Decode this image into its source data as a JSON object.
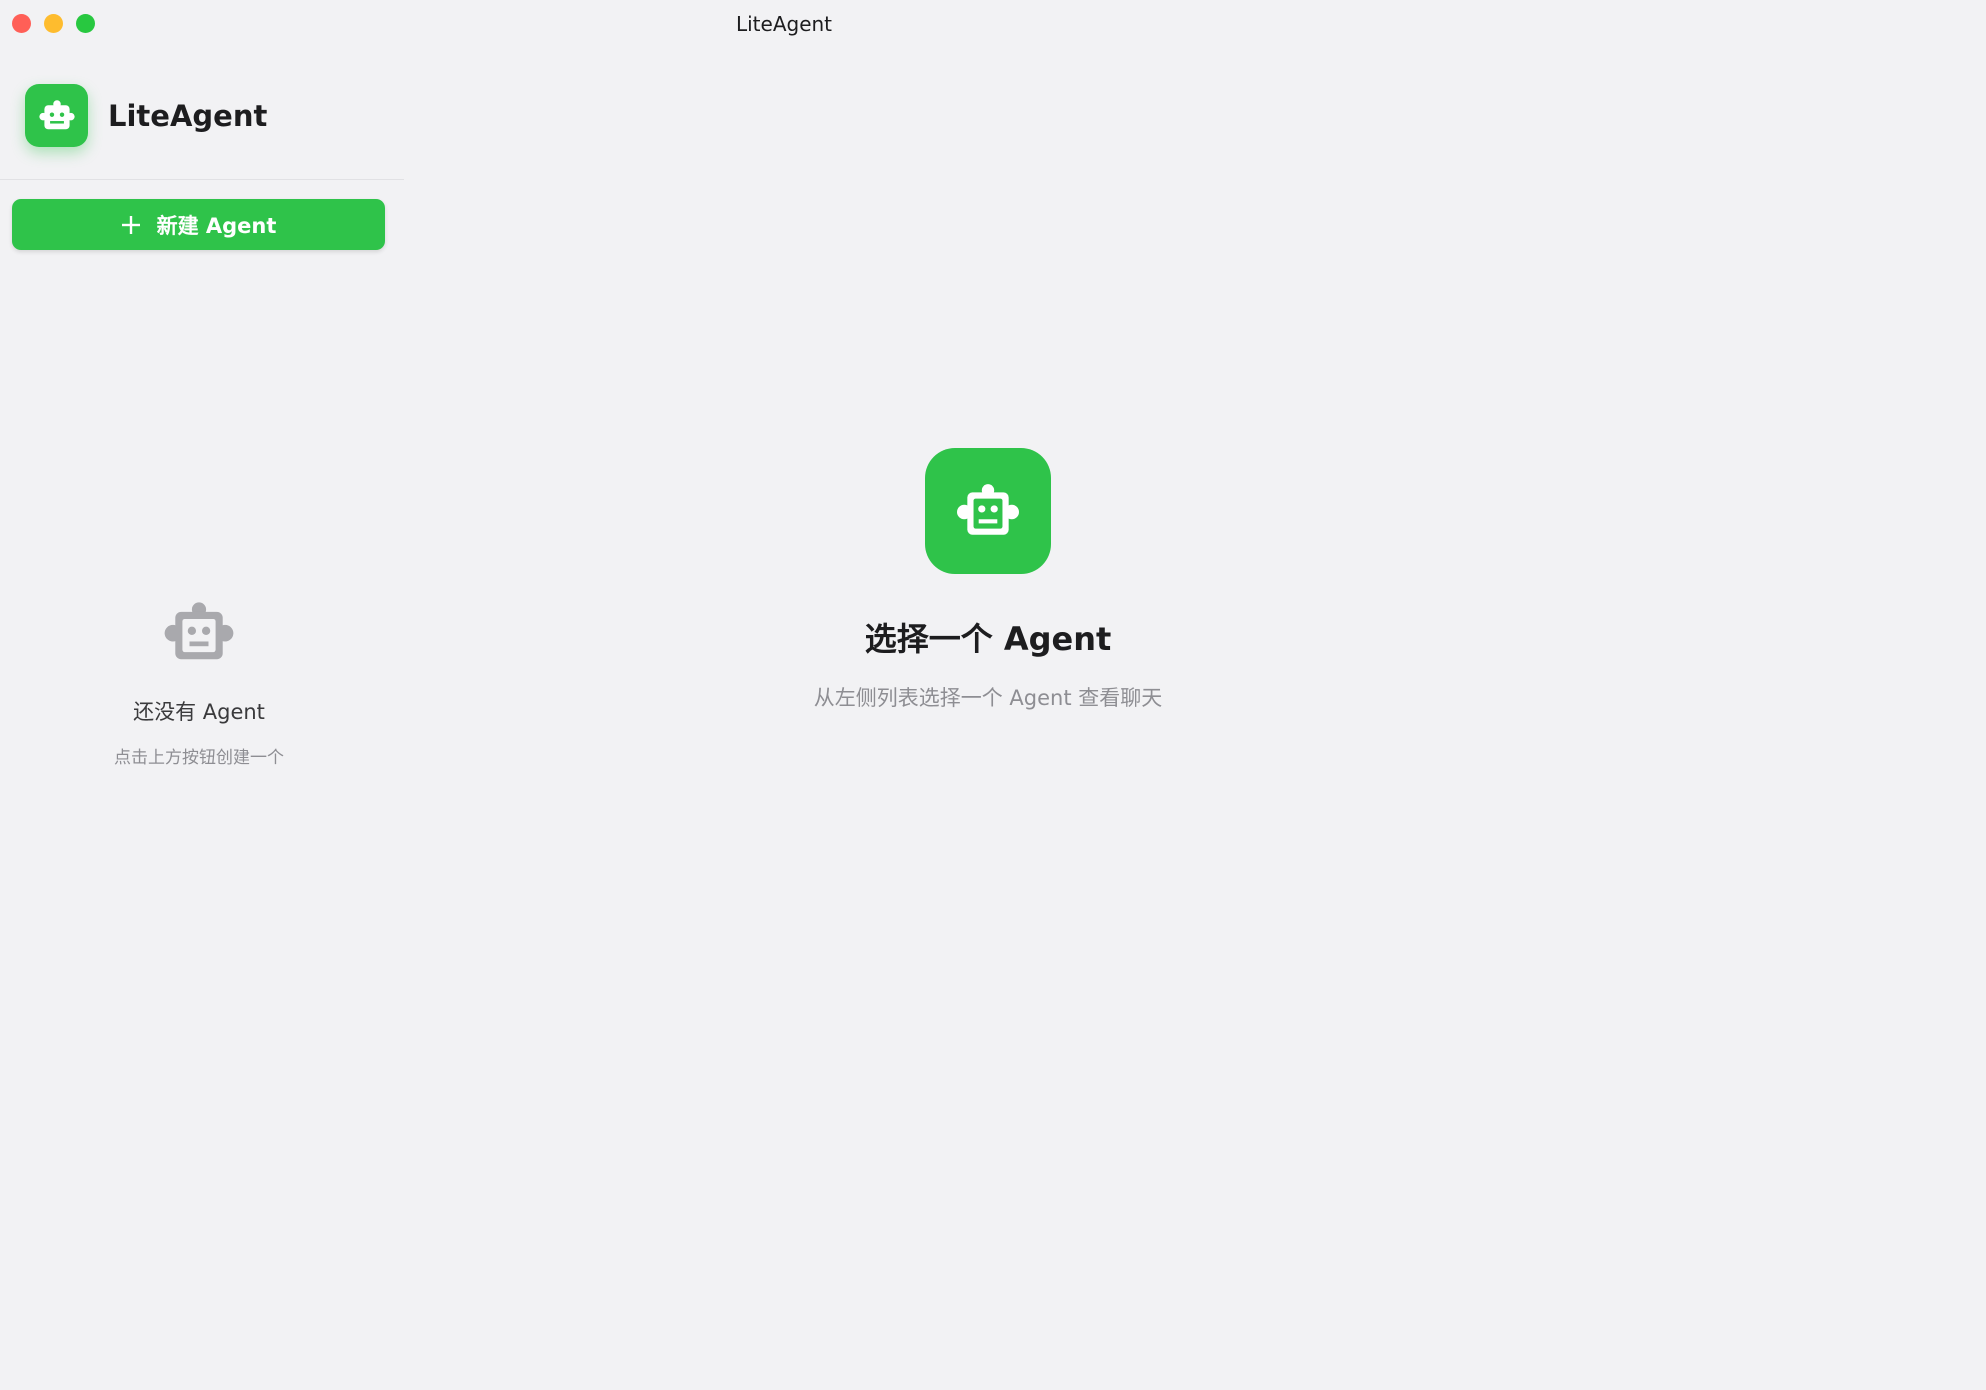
{
  "window": {
    "title": "LiteAgent"
  },
  "sidebar": {
    "app_name": "LiteAgent",
    "new_button_label": "新建 Agent",
    "empty_title": "还没有 Agent",
    "empty_subtitle": "点击上方按钮创建一个"
  },
  "main": {
    "title": "选择一个 Agent",
    "subtitle": "从左侧列表选择一个 Agent 查看聊天"
  },
  "icons": {
    "app_logo": "robot-icon",
    "new_button": "plus-icon",
    "empty_state": "robot-icon",
    "main": "robot-icon"
  },
  "colors": {
    "accent": "#2fc34a",
    "background": "#f2f2f4",
    "muted_icon": "#a9a9ad"
  }
}
